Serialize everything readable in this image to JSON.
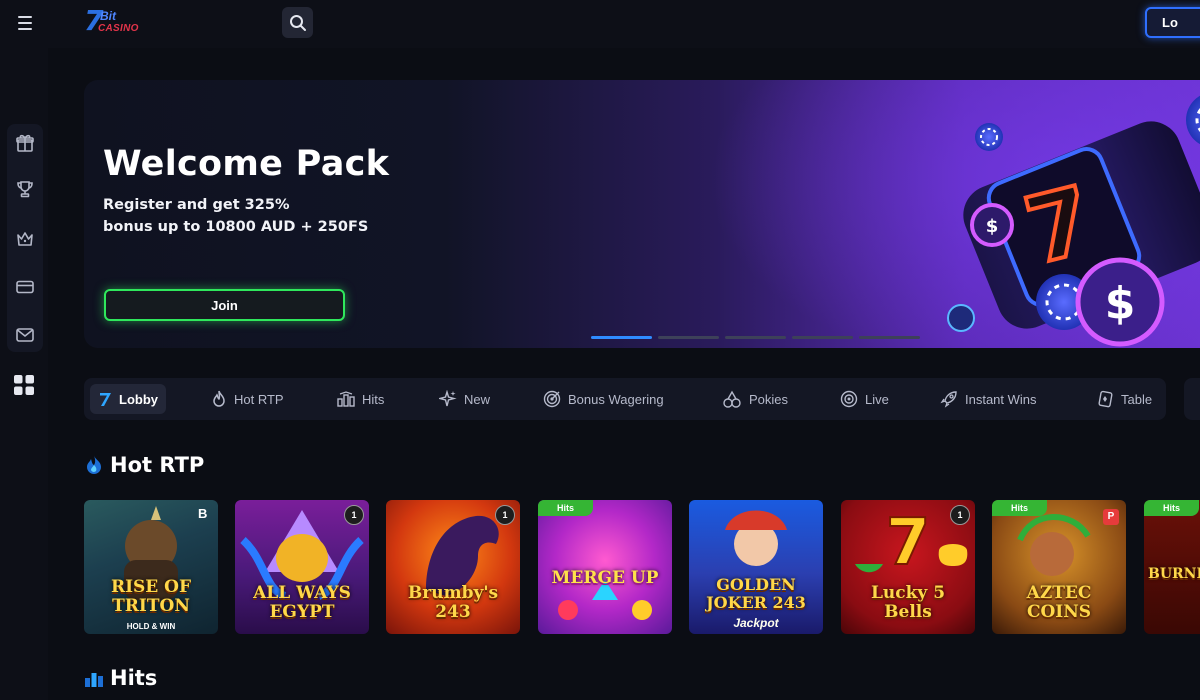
{
  "app": {
    "logo_number": "7",
    "logo_bit": "Bit",
    "logo_casino": "CASINO",
    "login_label": "Lo"
  },
  "sidebar": {
    "items": [
      {
        "icon": "gift-icon"
      },
      {
        "icon": "trophy-icon"
      },
      {
        "icon": "crown-icon"
      },
      {
        "icon": "card-icon"
      },
      {
        "icon": "mail-icon"
      }
    ],
    "extra_icon": "grid-icon"
  },
  "banner": {
    "title": "Welcome Pack",
    "subtitle_line1": "Register and get 325%",
    "subtitle_line2": "bonus up to 10800 AUD + 250FS",
    "join_label": "Join",
    "slides": 5,
    "active_slide": 0
  },
  "categories": [
    {
      "label": "Lobby",
      "icon": "seven-logo-icon",
      "active": true
    },
    {
      "label": "Hot RTP",
      "icon": "flame-icon",
      "active": false
    },
    {
      "label": "Hits",
      "icon": "bar-chart-icon",
      "active": false
    },
    {
      "label": "New",
      "icon": "sparkle-icon",
      "active": false
    },
    {
      "label": "Bonus Wagering",
      "icon": "target-icon",
      "active": false
    },
    {
      "label": "Pokies",
      "icon": "cherries-icon",
      "active": false
    },
    {
      "label": "Live",
      "icon": "live-icon",
      "active": false
    },
    {
      "label": "Instant Wins",
      "icon": "rocket-icon",
      "active": false
    },
    {
      "label": "Table",
      "icon": "table-card-icon",
      "active": false
    }
  ],
  "sections": {
    "hot_rtp_title": "Hot RTP",
    "hits_title": "Hits"
  },
  "games": [
    {
      "name": "RISE OF TRITON",
      "sub": "HOLD & WIN",
      "badge": "",
      "provider": "B"
    },
    {
      "name": "ALL WAYS EGYPT",
      "sub": "",
      "badge": "",
      "provider": "1"
    },
    {
      "name": "Brumby's 243",
      "sub": "",
      "badge": "",
      "provider": "1"
    },
    {
      "name": "MERGE UP",
      "sub": "",
      "badge": "Hits",
      "provider": ""
    },
    {
      "name": "GOLDEN JOKER 243",
      "sub": "Jackpot",
      "badge": "",
      "provider": ""
    },
    {
      "name": "Lucky 5 Bells",
      "sub": "",
      "badge": "",
      "provider": "1"
    },
    {
      "name": "AZTEC COINS",
      "sub": "",
      "badge": "Hits",
      "provider": "P"
    },
    {
      "name": "BURNIN",
      "sub": "",
      "badge": "Hits",
      "provider": ""
    }
  ],
  "colors": {
    "background": "#0b0d14",
    "panel": "#141724",
    "accent_blue": "#2f6fff",
    "accent_green": "#2fe85c",
    "hits_badge": "#35b534"
  }
}
